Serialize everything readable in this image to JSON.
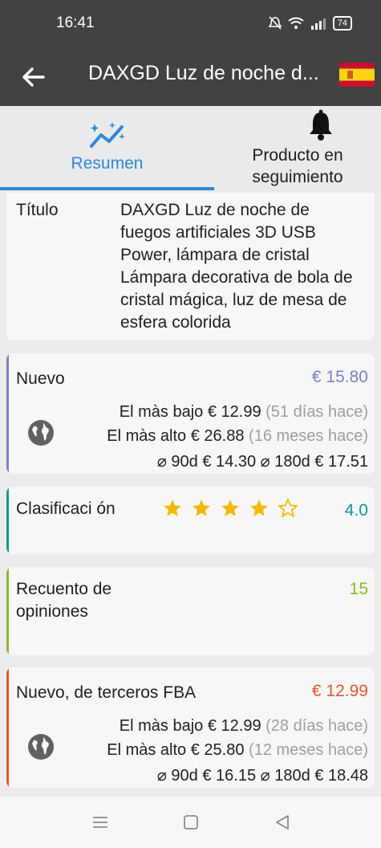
{
  "status_bar": {
    "time": "16:41",
    "battery": "74"
  },
  "app_bar": {
    "title": "DAXGD Luz de noche d..."
  },
  "tabs": [
    {
      "label": "Resumen"
    },
    {
      "label": "Producto en seguimiento"
    }
  ],
  "title_row": {
    "label": "Título",
    "value": "DAXGD Luz de noche de fuegos artificiales 3D USB Power, lámpara de cristal Lámpara decorativa de bola de cristal mágica, luz de mesa de esfera colorida"
  },
  "nuevo": {
    "label": "Nuevo",
    "price": "€ 15.80",
    "color": "#7b7fc4",
    "lowest_label": "El màs bajo",
    "lowest_price": "€ 12.99",
    "lowest_when": "(51 días hace)",
    "highest_label": "El màs alto",
    "highest_price": "€ 26.88",
    "highest_when": "(16 meses hace)",
    "avg": "⌀ 90d € 14.30 ⌀ 180d € 17.51"
  },
  "rating": {
    "label": "Clasificaci ón",
    "value": "4.0",
    "stars": 4,
    "max_stars": 5,
    "color": "#11998e"
  },
  "reviews": {
    "label": "Recuento de opiniones",
    "value": "15",
    "color": "#8bb82a"
  },
  "fba": {
    "label": "Nuevo, de terceros FBA",
    "price": "€ 12.99",
    "color": "#e4572e",
    "lowest_label": "El màs bajo",
    "lowest_price": "€ 12.99",
    "lowest_when": "(28 días hace)",
    "highest_label": "El màs alto",
    "highest_price": "€ 25.80",
    "highest_when": "(12 meses hace)",
    "avg": "⌀ 90d € 16.15 ⌀ 180d € 18.48"
  },
  "icons": {
    "back": "arrow-left-icon",
    "flag": "spain-flag-icon",
    "tab1": "chart-sparkle-icon",
    "tab2": "bell-icon",
    "globe": "globe-icon"
  }
}
